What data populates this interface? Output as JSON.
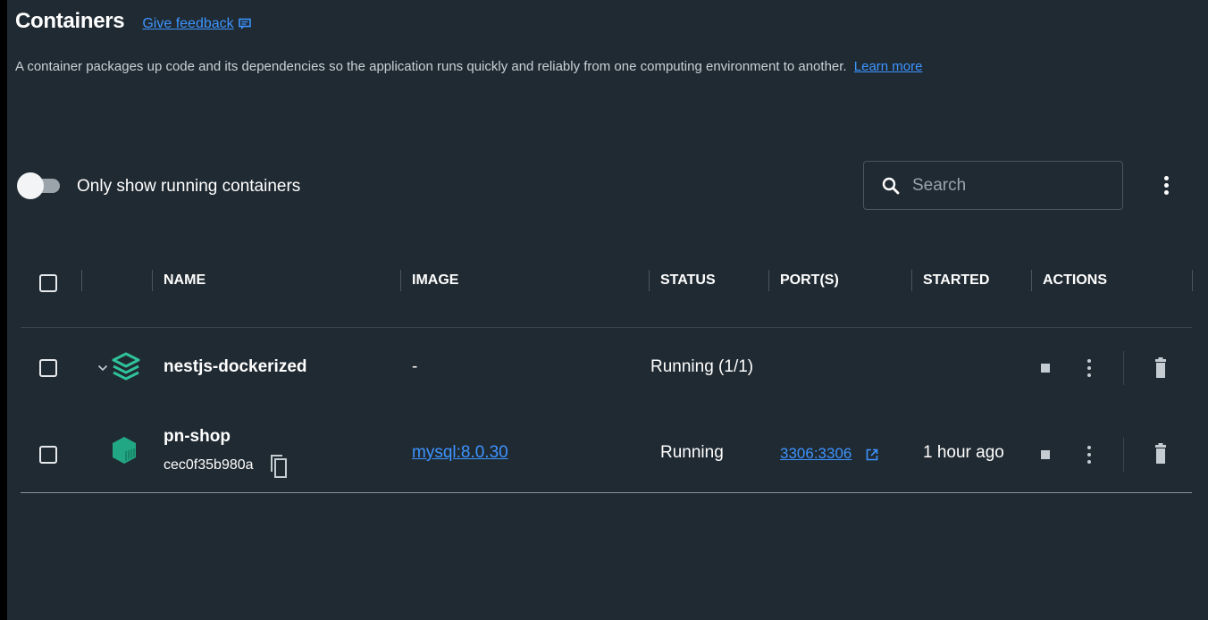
{
  "page": {
    "title": "Containers",
    "feedback_label": "Give feedback",
    "description": "A container packages up code and its dependencies so the application runs quickly and reliably from one computing environment to another.",
    "learn_more": "Learn more"
  },
  "filter": {
    "toggle_label": "Only show running containers",
    "toggle_on": false
  },
  "search": {
    "placeholder": "Search",
    "value": ""
  },
  "table": {
    "columns": [
      "NAME",
      "IMAGE",
      "STATUS",
      "PORT(S)",
      "STARTED",
      "ACTIONS"
    ],
    "rows": [
      {
        "name": "nestjs-dockerized",
        "id": "",
        "image": "-",
        "status": "Running (1/1)",
        "ports": "",
        "started": ""
      },
      {
        "name": "pn-shop",
        "id": "cec0f35b980a",
        "image": "mysql:8.0.30",
        "status": "Running",
        "ports": "3306:3306",
        "started": "1 hour ago"
      }
    ]
  },
  "colors": {
    "background": "#202a32",
    "link": "#3d94ff",
    "compose_icon": "#2fc39b",
    "container_icon": "#22a784"
  },
  "icons": {
    "feedback": "feedback-icon",
    "search": "search-icon",
    "more": "kebab-menu-icon",
    "expand": "chevron-down-icon",
    "compose": "stack-layers-icon",
    "container": "container-cube-icon",
    "copy": "copy-icon",
    "external": "external-link-icon",
    "stop": "stop-icon",
    "delete": "trash-icon"
  }
}
